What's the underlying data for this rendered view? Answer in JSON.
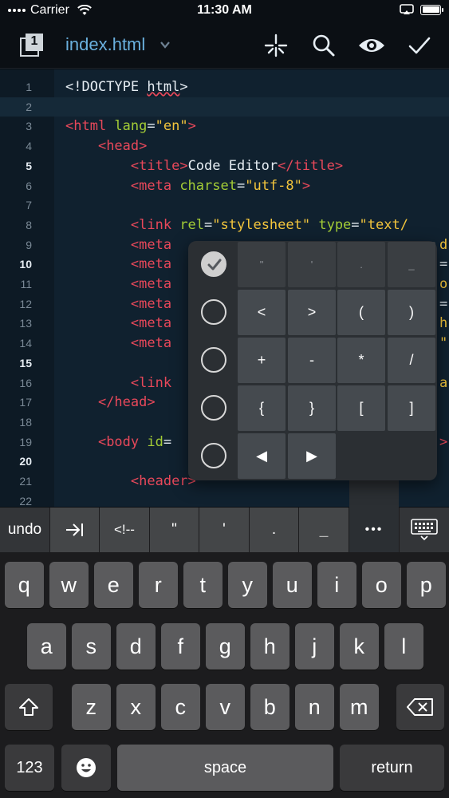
{
  "status_bar": {
    "carrier": "Carrier",
    "time": "11:30 AM",
    "battery_level": 1.0
  },
  "nav": {
    "tab_count": "1",
    "file_name": "index.html",
    "icons": [
      "tabs-icon",
      "chevron-down-icon",
      "sparkle-icon",
      "search-icon",
      "eye-icon",
      "checkmark-icon"
    ]
  },
  "editor": {
    "current_line": 2,
    "bold_line_numbers": [
      "5",
      "10",
      "15",
      "20"
    ],
    "lines": [
      {
        "num": "1",
        "code": "<!DOCTYPE html>"
      },
      {
        "num": "2",
        "code": ""
      },
      {
        "num": "3",
        "code": "<html lang=\"en\">"
      },
      {
        "num": "4",
        "code": "    <head>"
      },
      {
        "num": "5",
        "code": "        <title>Code Editor</title>"
      },
      {
        "num": "6",
        "code": "        <meta charset=\"utf-8\">"
      },
      {
        "num": "7",
        "code": ""
      },
      {
        "num": "8",
        "code": "        <link rel=\"stylesheet\" type=\"text/"
      },
      {
        "num": "9",
        "code": "        <meta"
      },
      {
        "num": "10",
        "code": "        <meta"
      },
      {
        "num": "11",
        "code": "        <meta"
      },
      {
        "num": "12",
        "code": "        <meta"
      },
      {
        "num": "13",
        "code": "        <meta"
      },
      {
        "num": "14",
        "code": "        <meta"
      },
      {
        "num": "15",
        "code": ""
      },
      {
        "num": "16",
        "code": "        <link"
      },
      {
        "num": "17",
        "code": "    </head>"
      },
      {
        "num": "18",
        "code": ""
      },
      {
        "num": "19",
        "code": "    <body id="
      },
      {
        "num": "20",
        "code": ""
      },
      {
        "num": "21",
        "code": "        <header>"
      },
      {
        "num": "22",
        "code": ""
      }
    ],
    "right_clipped_chars": [
      {
        "line": "9",
        "char": "d"
      },
      {
        "line": "10",
        "char": "="
      },
      {
        "line": "11",
        "char": "o"
      },
      {
        "line": "12",
        "char": "="
      },
      {
        "line": "13",
        "char": "h"
      },
      {
        "line": "14",
        "char": "\""
      },
      {
        "line": "16",
        "char": "a"
      },
      {
        "line": "19",
        "char": ">"
      }
    ]
  },
  "symbol_popup": {
    "rows": [
      {
        "checked": true,
        "keys": [
          "\"",
          "'",
          ".",
          "_"
        ]
      },
      {
        "checked": false,
        "keys": [
          "<",
          ">",
          "(",
          ")"
        ]
      },
      {
        "checked": false,
        "keys": [
          "+",
          "-",
          "*",
          "/"
        ]
      },
      {
        "checked": false,
        "keys": [
          "{",
          "}",
          "[",
          "]"
        ]
      },
      {
        "checked": false,
        "keys": [
          "◀",
          "▶"
        ]
      }
    ]
  },
  "accessory_bar": {
    "undo": "undo",
    "tab_icon": "tab-indent-icon",
    "comment": "<!--",
    "symbols": [
      "\"",
      "'",
      ".",
      "_"
    ],
    "more": "•••",
    "keyboard_icon": "keyboard-dismiss-icon"
  },
  "keyboard": {
    "row1": [
      "q",
      "w",
      "e",
      "r",
      "t",
      "y",
      "u",
      "i",
      "o",
      "p"
    ],
    "row2": [
      "a",
      "s",
      "d",
      "f",
      "g",
      "h",
      "j",
      "k",
      "l"
    ],
    "row3": [
      "z",
      "x",
      "c",
      "v",
      "b",
      "n",
      "m"
    ],
    "numbers_key": "123",
    "space": "space",
    "return": "return"
  }
}
